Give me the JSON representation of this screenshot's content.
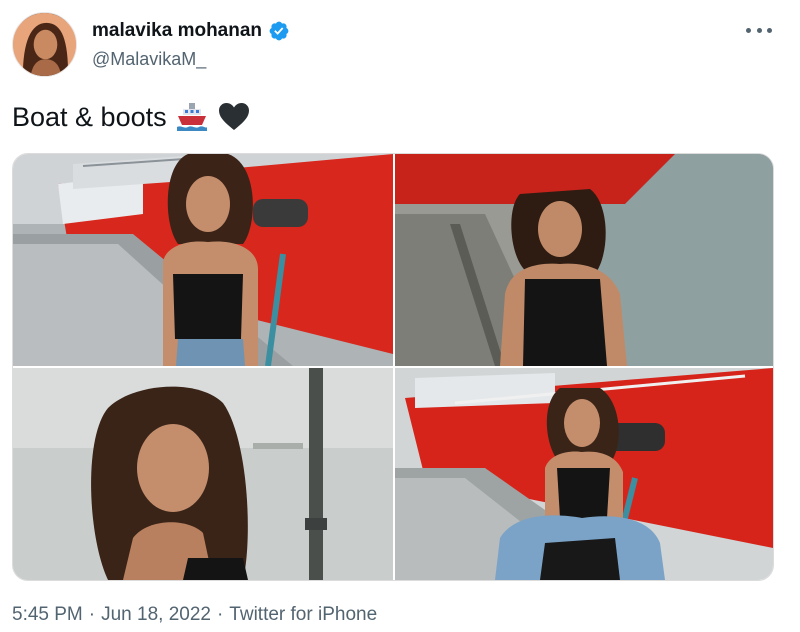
{
  "author": {
    "display_name": "malavika mohanan",
    "handle": "@MalavikaM_",
    "verified": true,
    "avatar_icon": "profile-avatar"
  },
  "tweet": {
    "text": "Boat & boots",
    "emojis": [
      "ship-emoji",
      "black-heart-emoji"
    ]
  },
  "media": {
    "count": 4,
    "items": [
      {
        "id": "photo-1",
        "subject": "woman-on-dock-red-boat"
      },
      {
        "id": "photo-2",
        "subject": "woman-on-pier-water"
      },
      {
        "id": "photo-3",
        "subject": "woman-portrait-sea-pole"
      },
      {
        "id": "photo-4",
        "subject": "woman-squatting-red-boat"
      }
    ]
  },
  "meta": {
    "time": "5:45 PM",
    "sep1": "·",
    "date": "Jun 18, 2022",
    "sep2": "·",
    "source": "Twitter for iPhone"
  },
  "colors": {
    "verified_blue": "#1d9bf0",
    "text_primary": "#0f1419",
    "text_secondary": "#536471",
    "boat_red": "#d8271c"
  }
}
